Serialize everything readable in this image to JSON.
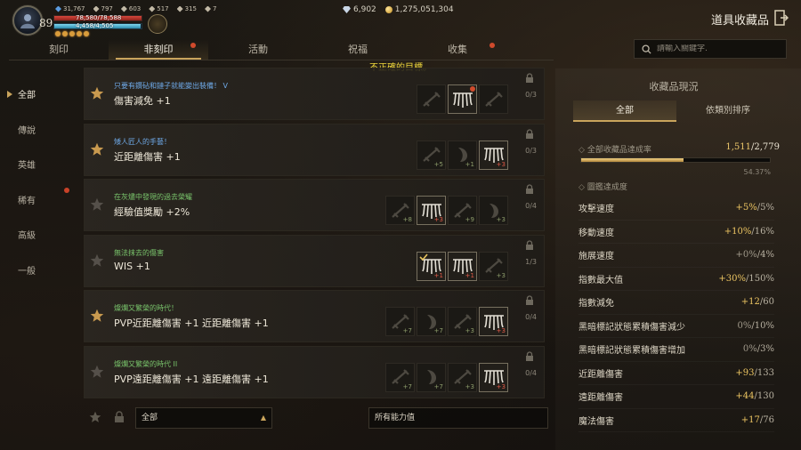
{
  "hud": {
    "level": "89",
    "stats": [
      "31,767",
      "797",
      "603",
      "517",
      "315",
      "7"
    ],
    "hp_text": "78,580/78,588",
    "hp_fraction": 0.999,
    "mp_text": "4,458/4,505",
    "mp_fraction": 0.99,
    "currency": {
      "gems": "6,902",
      "gold": "1,275,051,304"
    },
    "title": "道具收藏品"
  },
  "tabs": [
    {
      "label": "刻印",
      "active": false,
      "dot": false
    },
    {
      "label": "非刻印",
      "active": true,
      "dot": true
    },
    {
      "label": "活動",
      "active": false,
      "dot": false
    },
    {
      "label": "祝福",
      "active": false,
      "dot": false
    },
    {
      "label": "收集",
      "active": false,
      "dot": true
    }
  ],
  "search": {
    "placeholder": "請輸入關鍵字."
  },
  "warning": "不正確的目標。",
  "nav": [
    {
      "label": "全部",
      "active": true,
      "dot": false
    },
    {
      "label": "傳說",
      "active": false,
      "dot": false
    },
    {
      "label": "英雄",
      "active": false,
      "dot": false
    },
    {
      "label": "稀有",
      "active": false,
      "dot": true
    },
    {
      "label": "高級",
      "active": false,
      "dot": false
    },
    {
      "label": "一般",
      "active": false,
      "dot": false
    }
  ],
  "collections": [
    {
      "subtitle": "只要有鑽砧和鏈子就能變出裝備！ V",
      "subtitle_color": "#6ea8e6",
      "effect": "傷害減免 +1",
      "starred": true,
      "progress": "0/3",
      "items": [
        {
          "owned": false,
          "count": "",
          "dot": false
        },
        {
          "owned": true,
          "count": "",
          "dot": true
        },
        {
          "owned": false,
          "count": "",
          "dot": false
        }
      ]
    },
    {
      "subtitle": "矮人匠人的手藝！",
      "subtitle_color": "#6ea8e6",
      "effect": "近距離傷害 +1",
      "starred": true,
      "progress": "0/3",
      "items": [
        {
          "owned": false,
          "count": "+5",
          "dot": false
        },
        {
          "owned": false,
          "count": "+1",
          "dot": false
        },
        {
          "owned": true,
          "count": "+3",
          "dot": false
        }
      ]
    },
    {
      "subtitle": "在灰燼中發現的過去榮耀",
      "subtitle_color": "#79c46b",
      "effect": "經驗值獎勵 +2%",
      "starred": false,
      "progress": "0/4",
      "items": [
        {
          "owned": false,
          "count": "+8",
          "dot": false
        },
        {
          "owned": true,
          "count": "+3",
          "dot": false
        },
        {
          "owned": false,
          "count": "+9",
          "dot": false
        },
        {
          "owned": false,
          "count": "+3",
          "dot": false
        }
      ]
    },
    {
      "subtitle": "無法抹去的傷害",
      "subtitle_color": "#79c46b",
      "effect": "WIS +1",
      "starred": false,
      "progress": "1/3",
      "items": [
        {
          "owned": true,
          "count": "+1",
          "dot": false,
          "check": true
        },
        {
          "owned": true,
          "count": "+1",
          "dot": false
        },
        {
          "owned": false,
          "count": "+3",
          "dot": false
        }
      ]
    },
    {
      "subtitle": "燦爛又繁榮的時代！",
      "subtitle_color": "#79c46b",
      "effect": "PVP近距離傷害 +1 近距離傷害 +1",
      "starred": true,
      "progress": "0/4",
      "items": [
        {
          "owned": false,
          "count": "+7",
          "dot": false
        },
        {
          "owned": false,
          "count": "+7",
          "dot": false
        },
        {
          "owned": false,
          "count": "+3",
          "dot": false
        },
        {
          "owned": true,
          "count": "+3",
          "dot": false
        }
      ]
    },
    {
      "subtitle": "燦爛又繁榮的時代 II",
      "subtitle_color": "#79c46b",
      "effect": "PVP遠距離傷害 +1 遠距離傷害 +1",
      "starred": false,
      "progress": "0/4",
      "items": [
        {
          "owned": false,
          "count": "+7",
          "dot": false
        },
        {
          "owned": false,
          "count": "+7",
          "dot": false
        },
        {
          "owned": false,
          "count": "+3",
          "dot": false
        },
        {
          "owned": true,
          "count": "+3",
          "dot": false
        }
      ]
    }
  ],
  "filters": {
    "category": "全部",
    "ability": "所有能力值"
  },
  "panel": {
    "title": "收藏品現況",
    "tabs": [
      {
        "label": "全部",
        "active": true
      },
      {
        "label": "依類別排序",
        "active": false
      }
    ],
    "overall_label": "全部收藏品達成率",
    "overall_done": "1,511",
    "overall_total": "/2,779",
    "overall_fraction": 0.5437,
    "overall_pct": "54.37%",
    "section_label": "圖鑑達成度",
    "stats": [
      {
        "label": "攻擊速度",
        "bonus": "+5%",
        "max": "/5%"
      },
      {
        "label": "移動速度",
        "bonus": "+10%",
        "max": "/16%"
      },
      {
        "label": "施展速度",
        "bonus": "+0%",
        "max": "/4%",
        "zero": true
      },
      {
        "label": "指數最大值",
        "bonus": "+30%",
        "max": "/150%"
      },
      {
        "label": "指數減免",
        "bonus": "+12",
        "max": "/60"
      },
      {
        "label": "黑暗標記狀態累積傷害減少",
        "bonus": "0%",
        "max": "/10%",
        "zero": true
      },
      {
        "label": "黑暗標記狀態累積傷害增加",
        "bonus": "0%",
        "max": "/3%",
        "zero": true
      },
      {
        "label": "近距離傷害",
        "bonus": "+93",
        "max": "/133"
      },
      {
        "label": "遠距離傷害",
        "bonus": "+44",
        "max": "/130"
      },
      {
        "label": "魔法傷害",
        "bonus": "+17",
        "max": "/76"
      }
    ]
  }
}
